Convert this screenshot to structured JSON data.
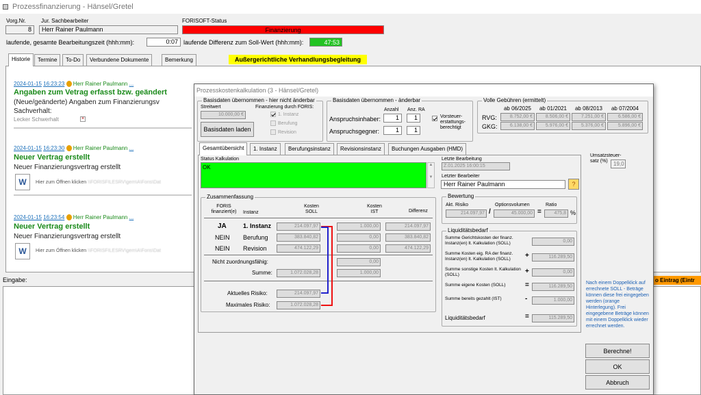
{
  "window": {
    "title": "Prozessfinanzierung - Hänsel/Gretel"
  },
  "header": {
    "vorg_label": "Vorg.Nr.",
    "vorg_value": "8",
    "sachbearbeiter_label": "Jur. Sachbearbeiter",
    "sachbearbeiter_value": "Herr Rainer Paulmann",
    "status_label": "FORISOFT-Status",
    "status_value": "Finanzierung",
    "bearbeitungszeit_label": "laufende, gesamte Bearbeitungszeit (hhh:mm):",
    "bearbeitungszeit_value": "0:07",
    "differenz_label": "laufende Differenz zum Soll-Wert (hhh:mm):",
    "differenz_value": "47:53"
  },
  "tabs": [
    "Historie",
    "Termine",
    "To-Do",
    "Verbundene Dokumente",
    "Bemerkung"
  ],
  "banner": "Außergerichtliche Verhandlungsbegleitung",
  "history": [
    {
      "date": "2024-01-15",
      "time": "16:23:23",
      "user": "Herr Rainer Paulmann",
      "link": "...",
      "title": "Angaben zum Vetrag erfasst bzw. geändert",
      "line1": "(Neue/geänderte) Angaben zum Finanzierungsv",
      "line2": "Sachverhalt:",
      "line3": "Lecker Schwerhalt"
    },
    {
      "date": "2024-01-15",
      "time": "16:23:30",
      "user": "Herr Rainer Paulmann",
      "link": "...",
      "title": "Neuer Vertrag erstellt",
      "line1": "Neuer Finanzierungsvertrag erstellt",
      "open": "Hier zum Öffnen klicken",
      "path": "\\\\FORISFILESRV\\gem\\A\\Foris\\Dat"
    },
    {
      "date": "2024-01-15",
      "time": "16:23:54",
      "user": "Herr Rainer Paulmann",
      "link": "...",
      "title": "Neuer Vertrag erstellt",
      "line1": "Neuer Finanzierungsvertrag erstellt",
      "open": "Hier zum Öffnen klicken",
      "path": "\\\\FORISFILESRV\\gem\\A\\Foris\\Dat"
    }
  ],
  "eingabe_label": "Eingabe:",
  "right_cut_label": "o Eintrag (Eintr",
  "dialog": {
    "title": "Prozesskostenkalkulation (3 - Hänsel/Gretel)",
    "basis": {
      "legend": "Basisdaten übernommen - hier nicht änderbar",
      "streitwert_label": "Streitwert",
      "streitwert_value": "10.000,00 €",
      "load_button": "Basisdaten laden",
      "finanzierung_label": "Finanzierung durch FORIS:",
      "opt1": "1. Instanz",
      "opt2": "Berufung",
      "opt3": "Revision"
    },
    "basis2": {
      "legend": "Basisdaten übernommen - änderbar",
      "anzahl_label": "Anzahl",
      "anzra_label": "Anz. RA",
      "inhaber_label": "Anspruchsinhaber:",
      "inhaber_anzahl": "1",
      "inhaber_ra": "1",
      "gegner_label": "Anspruchsgegner:",
      "gegner_anzahl": "1",
      "gegner_ra": "1",
      "vorsteuer_label": "Vorsteuer-erstattungs-berechtigt"
    },
    "gebuehren": {
      "legend": "Volle Gebühren (ermittelt)",
      "cols": [
        "ab 06/2025",
        "ab 01/2021",
        "ab 08/2013",
        "ab 07/2004"
      ],
      "rvg_label": "RVG:",
      "gkg_label": "GKG:",
      "rvg_values": [
        "8.752,00 €",
        "8.506,00 €",
        "7.251,00 €",
        "6.586,00 €"
      ],
      "gkg_values": [
        "6.138,00 €",
        "5.976,00 €",
        "5.376,00 €",
        "5.896,00 €"
      ]
    },
    "tabs": [
      "Gesamtübersicht",
      "1. Instanz",
      "Berufungsinstanz",
      "Revisionsinstanz",
      "Buchungen Ausgaben (HMD)"
    ],
    "status_label": "Status Kalkulation",
    "status_value": "OK",
    "letzte_bearbeitung_label": "Letzte Bearbeitung",
    "letzte_bearbeitung_value": "Z.01.2025 16:00:15",
    "letzter_bearbeiter_label": "Letzter Bearbeiter",
    "letzter_bearbeiter_value": "Herr Rainer Paulmann",
    "umsatzsteuer_label": "Umsatzsteuer-satz (%)",
    "umsatzsteuer_value": "19,0",
    "zusammenfassung": {
      "legend": "Zusammenfassung",
      "col_foris": "FORIS finanziert(e)",
      "col_instanz": "Instanz",
      "col_soll": "Kosten SOLL",
      "col_ist": "Kosten IST",
      "col_diff": "Differenz",
      "rows": [
        {
          "foris": "JA",
          "instanz": "1. Instanz",
          "soll": "214.097,97",
          "ist": "1.000,00",
          "diff": "214.097,97"
        },
        {
          "foris": "NEIN",
          "instanz": "Berufung",
          "soll": "383.840,82",
          "ist": "0,00",
          "diff": "383.840,82"
        },
        {
          "foris": "NEIN",
          "instanz": "Revision",
          "soll": "474.122,29",
          "ist": "0,00",
          "diff": "474.122,29"
        }
      ],
      "nicht_label": "Nicht zuordnungsfähig:",
      "nicht_value": "0,00",
      "summe_label": "Summe:",
      "summe_soll": "1.072.028,28",
      "summe_ist": "1.000,00",
      "risiko_label": "Aktuelles Risiko:",
      "risiko_value": "214.097,97",
      "max_label": "Maximales Risiko:",
      "max_value": "1.072.028,28"
    },
    "bewertung": {
      "legend": "Bewertung",
      "risiko_label": "Akt. Risiko",
      "optionsvolumen_label": "Optionsvolumen",
      "ratio_label": "Ratio",
      "risiko_value": "214.097,97",
      "optionsvolumen_value": "45.000,00",
      "ratio_value": "475,8",
      "slash": "/",
      "equals": "=",
      "percent": "%"
    },
    "liquiditaet": {
      "legend": "Liquiditätsbedarf",
      "rows": [
        {
          "label": "Summe Gerichtskosten der finanz. Instanz(en) lt. Kalkulation (SOLL)",
          "op": "",
          "value": "0,00"
        },
        {
          "label": "Summe Kosten eig. RA der finanz. Instanz(en) lt. Kalkulation (SOLL)",
          "op": "+",
          "value": "116.289,50"
        },
        {
          "label": "Summe sonstige Kosten lt. Kalkulation (SOLL)",
          "op": "+",
          "value": "0,00"
        },
        {
          "label": "Summe eigene Kosten (SOLL)",
          "op": "=",
          "value": "116.289,50"
        },
        {
          "label": "Summe bereits gezahlt (IST)",
          "op": "-",
          "value": "1.000,00"
        },
        {
          "label": "Liquiditätsbedarf",
          "op": "=",
          "value": "115.289,50"
        }
      ]
    },
    "hint": "Nach einem Doppelklick auf errechnete SOLL - Beträge können diese frei eingegeben werden (orange Hinterlegung). Frei eingegebene Beträge können mit einem Doppelklick wieder errechnet werden.",
    "buttons": {
      "berechne": "Berechne!",
      "ok": "OK",
      "abbruch": "Abbruch"
    }
  },
  "colors": {
    "status_red": "#ff0000",
    "diff_green": "#22c322",
    "ok_green": "#00ff00",
    "banner_yellow": "#ffff00",
    "history_green": "#1a8a1a",
    "link_blue": "#1a6fba"
  }
}
